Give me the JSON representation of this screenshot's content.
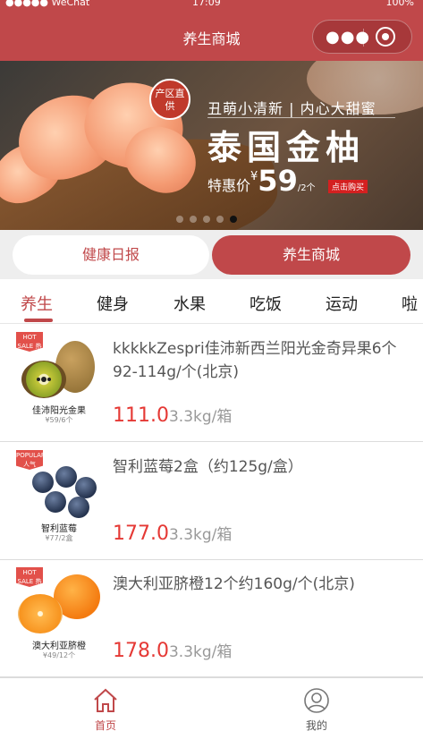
{
  "status_bar": {
    "carrier": "●●●●● WeChat ",
    "time": "17:09",
    "battery": "100%"
  },
  "navbar": {
    "title": "养生商城",
    "more_icon": "ellipsis-icon",
    "close_icon": "target-icon"
  },
  "banner": {
    "badge": "产区直供",
    "slogan": "丑萌小清新 | 内心大甜蜜",
    "headline": "泰国金柚",
    "price_label": "特惠价",
    "currency": "¥",
    "price": "59",
    "unit": "/2个",
    "buy_tag": "点击购买",
    "slide_count": 5,
    "active_slide": 4
  },
  "segment": {
    "left": "健康日报",
    "right": "养生商城",
    "active": "right"
  },
  "tabs": [
    "养生",
    "健身",
    "水果",
    "吃饭",
    "运动",
    "啦"
  ],
  "active_tab": 0,
  "products": [
    {
      "tag": "HOT SALE 热卖",
      "thumb_name": "佳沛阳光金果",
      "thumb_sub": "¥59/6个",
      "title": "kkkkkZespri佳沛新西兰阳光金奇异果6个92-114g/个(北京)",
      "price": "111.0",
      "spec": "3.3kg/箱"
    },
    {
      "tag": "POPULAR 人气",
      "thumb_name": "智利蓝莓",
      "thumb_sub": "¥77/2盒",
      "title": "智利蓝莓2盒（约125g/盒）",
      "price": "177.0",
      "spec": "3.3kg/箱"
    },
    {
      "tag": "HOT SALE 热卖",
      "thumb_name": "澳大利亚脐橙",
      "thumb_sub": "¥49/12个",
      "title": "澳大利亚脐橙12个约160g/个(北京)",
      "price": "178.0",
      "spec": "3.3kg/箱"
    }
  ],
  "tabbar": {
    "home": "首页",
    "me": "我的",
    "active": "home"
  },
  "colors": {
    "brand": "#c0484a",
    "price": "#e53935"
  }
}
